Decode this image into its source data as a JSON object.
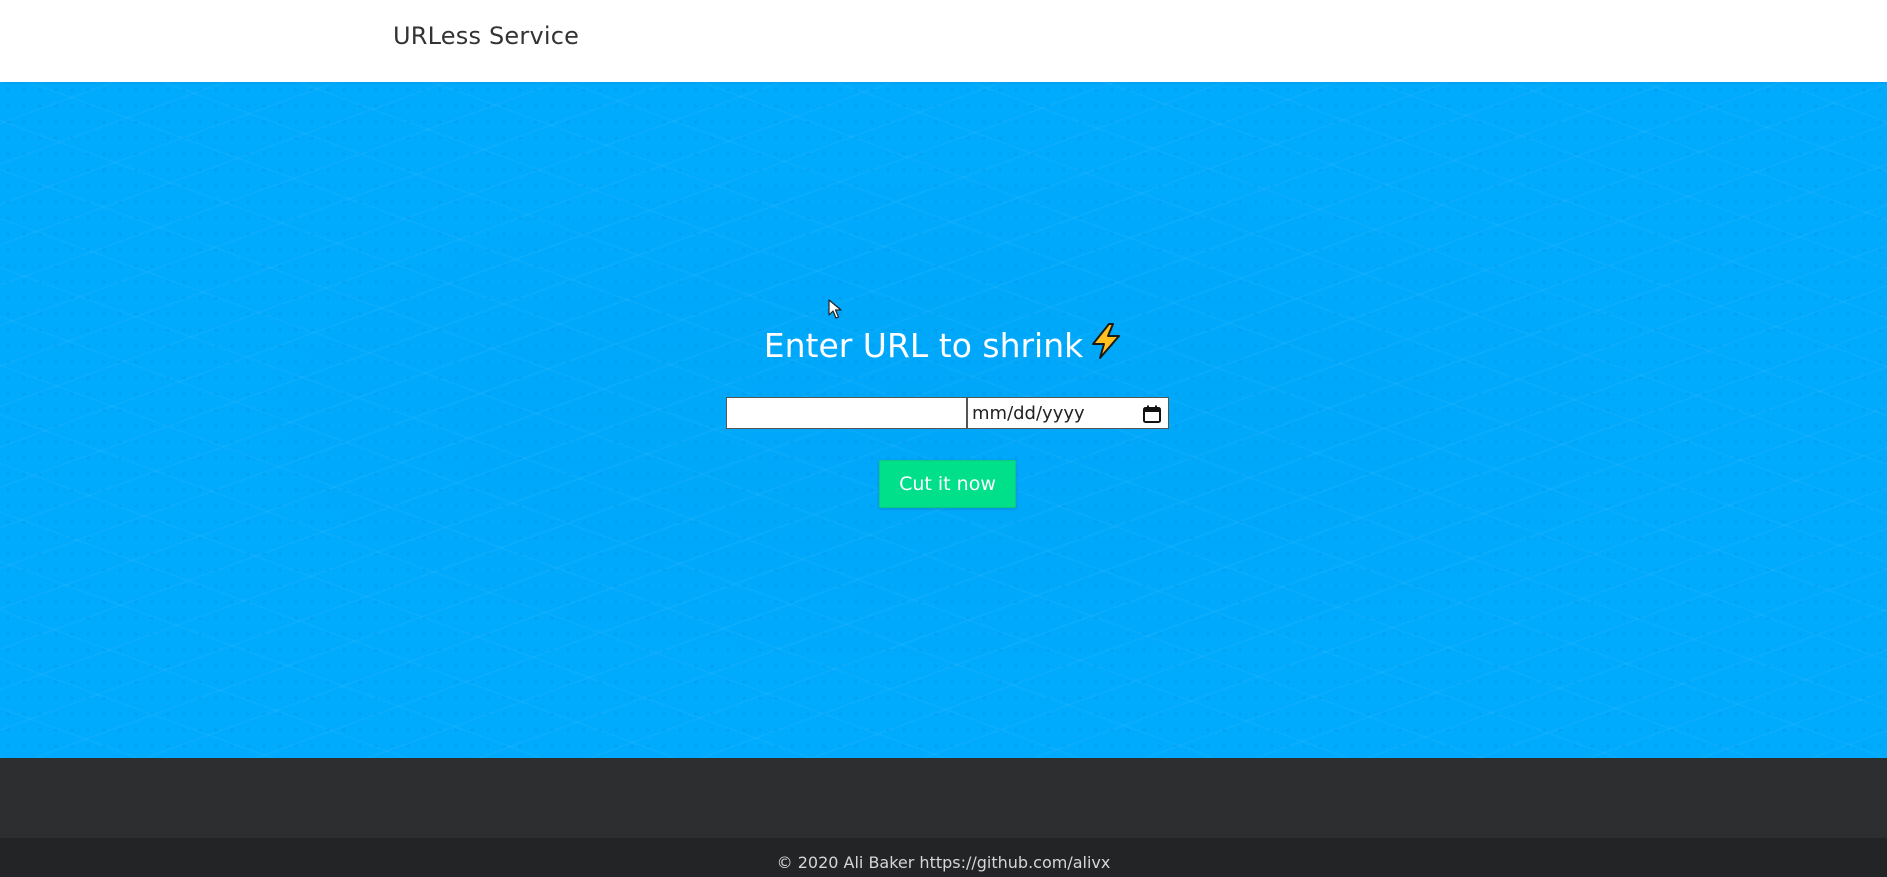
{
  "navbar": {
    "brand": "URLess Service"
  },
  "hero": {
    "title": "Enter URL to shrink",
    "title_icon": "lightning-bolt-icon",
    "url_input": {
      "value": "",
      "placeholder": ""
    },
    "date_input": {
      "placeholder": "mm/dd/yyyy",
      "icon": "calendar-icon"
    },
    "submit_label": "Cut it now"
  },
  "footer": {
    "copyright": "© 2020 Ali Baker https://github.com/alivx"
  },
  "colors": {
    "hero_background": "#00aafd",
    "button_background": "#00e08a",
    "footer_band": "#2d2e30",
    "footer_bar": "#232425",
    "bolt_fill": "#ffc020"
  }
}
